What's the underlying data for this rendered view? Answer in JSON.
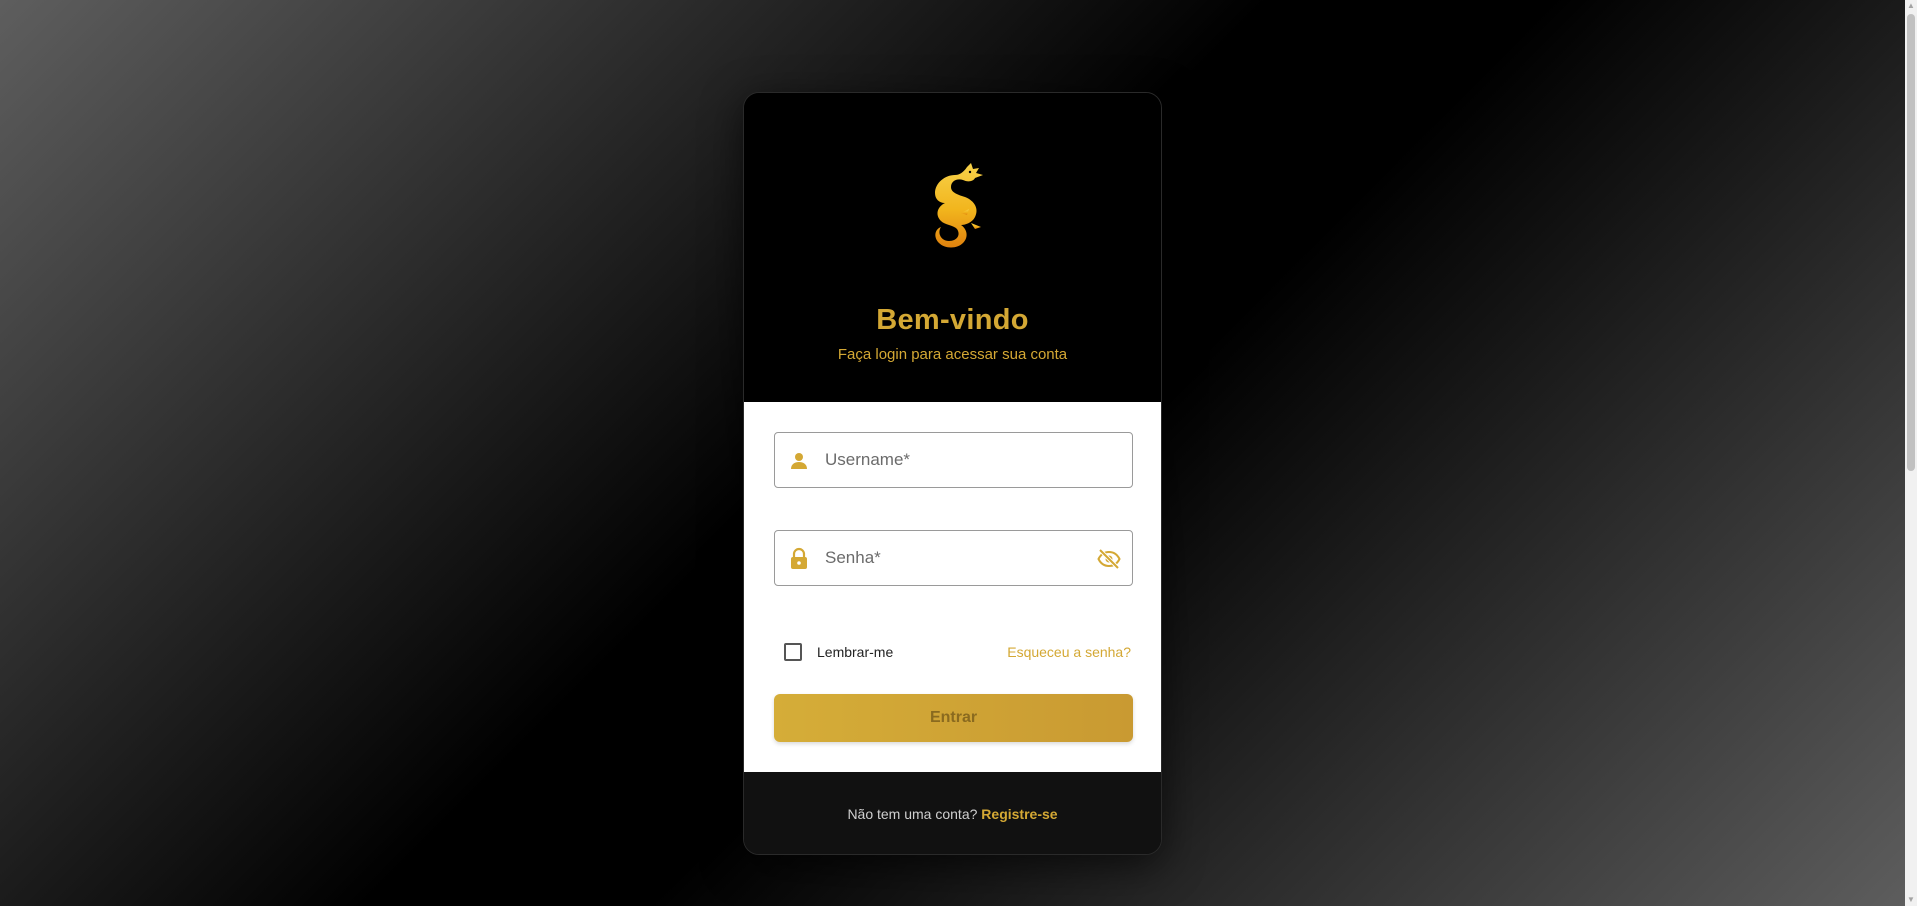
{
  "colors": {
    "accent": "#d4a834",
    "header_background": "#000000",
    "footer_background": "#111111",
    "form_background": "#ffffff"
  },
  "header": {
    "logo_icon": "dragon-logo-icon",
    "title": "Bem-vindo",
    "subtitle": "Faça login para acessar sua conta"
  },
  "form": {
    "username": {
      "icon": "person-icon",
      "placeholder": "Username*",
      "value": ""
    },
    "password": {
      "icon": "lock-icon",
      "placeholder": "Senha*",
      "value": "",
      "toggle_icon": "eye-off-icon"
    },
    "remember_me": {
      "label": "Lembrar-me",
      "checked": false
    },
    "forgot_password": "Esqueceu a senha?",
    "submit_label": "Entrar"
  },
  "footer": {
    "prompt": "Não tem uma conta?",
    "register_link": "Registre-se"
  }
}
